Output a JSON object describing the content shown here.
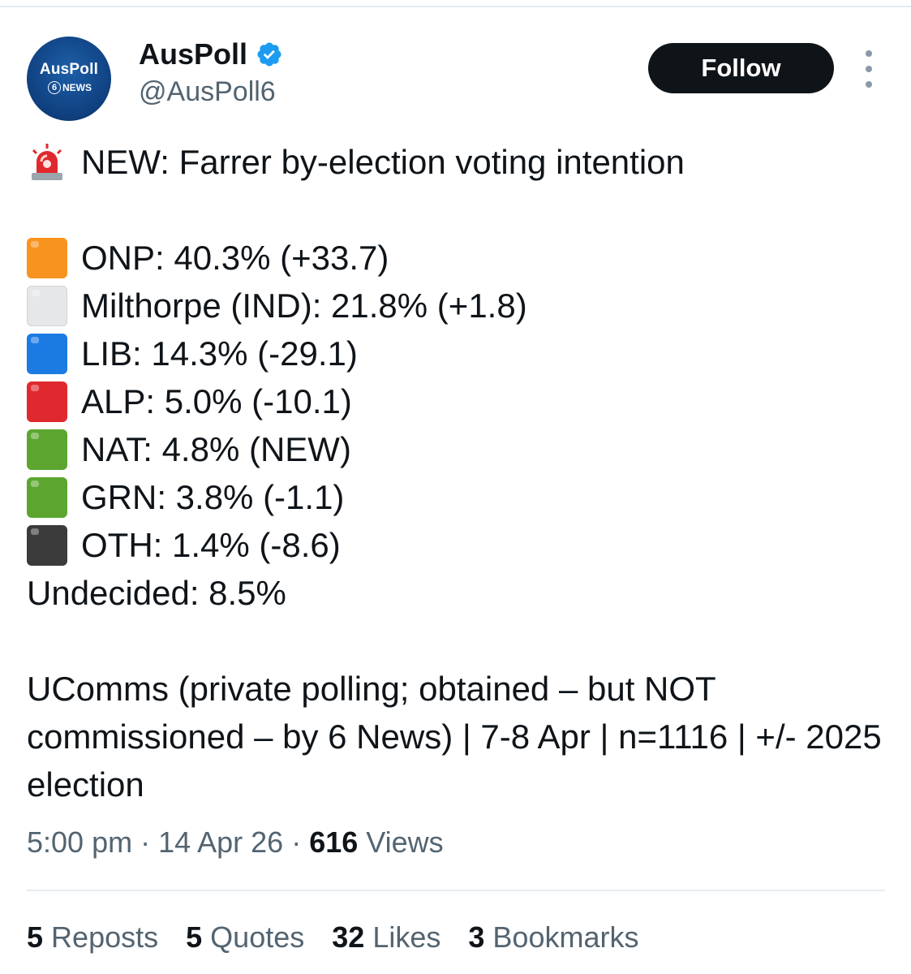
{
  "header": {
    "avatar_title": "AusPoll",
    "avatar_six": "6",
    "avatar_news": "NEWS",
    "display_name": "AusPoll",
    "handle": "@AusPoll6",
    "follow_label": "Follow"
  },
  "tweet": {
    "headline": "NEW: Farrer by-election voting intention",
    "results": [
      {
        "icon": "orange-square-icon",
        "color": "#f7931e",
        "text": "ONP: 40.3% (+33.7)"
      },
      {
        "icon": "white-square-icon",
        "color": "#e6e7e8",
        "text": "Milthorpe (IND): 21.8% (+1.8)"
      },
      {
        "icon": "blue-square-icon",
        "color": "#1c7ae3",
        "text": "LIB: 14.3% (-29.1)"
      },
      {
        "icon": "red-square-icon",
        "color": "#e0292e",
        "text": "ALP: 5.0% (-10.1)"
      },
      {
        "icon": "green-square-icon",
        "color": "#5ca62f",
        "text": "NAT: 4.8% (NEW)"
      },
      {
        "icon": "green-square-icon",
        "color": "#5ca62f",
        "text": "GRN: 3.8% (-1.1)"
      },
      {
        "icon": "black-square-icon",
        "color": "#3b3b3b",
        "text": "OTH: 1.4% (-8.6)"
      }
    ],
    "undecided": "Undecided: 8.5%",
    "source": "UComms (private polling; obtained – but NOT commissioned – by 6 News) | 7-8 Apr | n=1116 | +/- 2025 election"
  },
  "meta": {
    "time": "5:00 pm",
    "date": "14 Apr 26",
    "views_count": "616",
    "views_label": "Views",
    "separator": " · "
  },
  "stats": {
    "reposts_count": "5",
    "reposts_label": "Reposts",
    "quotes_count": "5",
    "quotes_label": "Quotes",
    "likes_count": "32",
    "likes_label": "Likes",
    "bookmarks_count": "3",
    "bookmarks_label": "Bookmarks"
  },
  "colors": {
    "verified": "#1d9bf0",
    "follow_bg": "#0f1419",
    "muted_text": "#536471",
    "siren_red": "#e0292e"
  }
}
